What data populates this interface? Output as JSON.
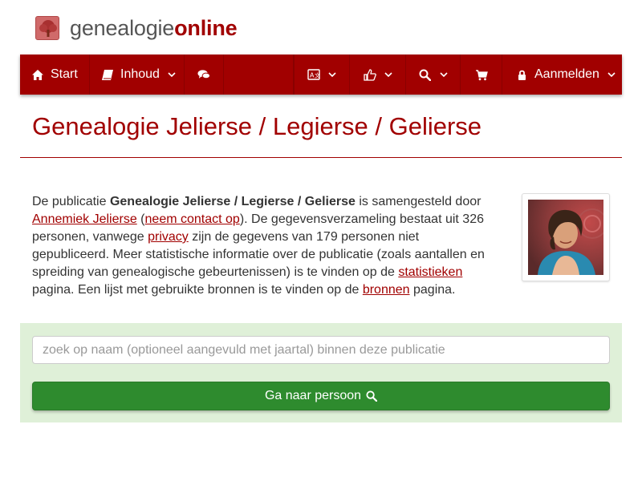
{
  "logo": {
    "text_part1": "genealogie",
    "text_part2": "online",
    "icon": "tree-logo-icon"
  },
  "navbar": {
    "items": [
      {
        "label": "Start",
        "icon": "home-icon"
      },
      {
        "label": "Inhoud",
        "icon": "book-icon",
        "dropdown": true
      },
      {
        "label": "",
        "icon": "comments-icon"
      },
      {
        "label": "",
        "icon": "language-icon",
        "dropdown": true
      },
      {
        "label": "",
        "icon": "thumbs-up-icon",
        "dropdown": true
      },
      {
        "label": "",
        "icon": "search-icon",
        "dropdown": true
      },
      {
        "label": "",
        "icon": "cart-icon"
      },
      {
        "label": "Aanmelden",
        "icon": "lock-icon",
        "dropdown": true
      }
    ]
  },
  "page": {
    "title": "Genealogie Jelierse / Legierse / Gelierse"
  },
  "description": {
    "t1": "De publicatie ",
    "publication": "Genealogie Jelierse / Legierse / Gelierse",
    "t2": " is samengesteld door ",
    "author_link": "Annemiek Jelierse",
    "t3": " (",
    "contact_link": "neem contact op",
    "t4": "). De gegevensverzameling bestaat uit 326 personen, vanwege ",
    "privacy_link": "privacy",
    "t5": " zijn de gegevens van 179 personen niet gepubliceerd. Meer statistische informatie over de publicatie (zoals aantallen en spreiding van genealogische gebeurtenissen) is te vinden op de ",
    "stats_link": "statistieken",
    "t6": " pagina. Een lijst met gebruikte bronnen is te vinden op de ",
    "sources_link": "bronnen",
    "t7": " pagina."
  },
  "search": {
    "placeholder": "zoek op naam (optioneel aangevuld met jaartal) binnen deze publicatie",
    "button_label": "Ga naar persoon",
    "button_icon": "search-icon"
  },
  "colors": {
    "brand": "#a10000",
    "panel": "#dff0d8",
    "button": "#2e8b2e"
  }
}
